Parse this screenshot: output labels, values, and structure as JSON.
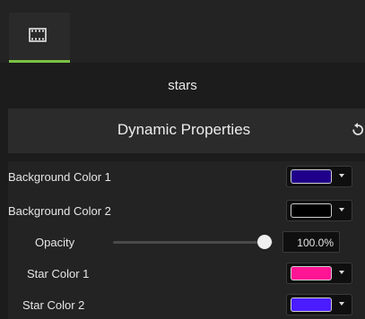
{
  "tabs": [
    {
      "icon": "film-strip-icon",
      "active": true
    }
  ],
  "accent_color": "#7bc143",
  "media_title": "stars",
  "section": {
    "title": "Dynamic Properties",
    "reset_icon": "reset-icon"
  },
  "properties": {
    "bg_color_1": {
      "label": "Background Color 1",
      "color": "#20008a"
    },
    "bg_color_2": {
      "label": "Background Color 2",
      "color": "#000000"
    },
    "opacity": {
      "label": "Opacity",
      "value": "100.0%",
      "level": 1.0
    },
    "star_color_1": {
      "label": "Star Color 1",
      "color": "#ff1493"
    },
    "star_color_2": {
      "label": "Star Color 2",
      "color": "#4a1cff"
    }
  }
}
